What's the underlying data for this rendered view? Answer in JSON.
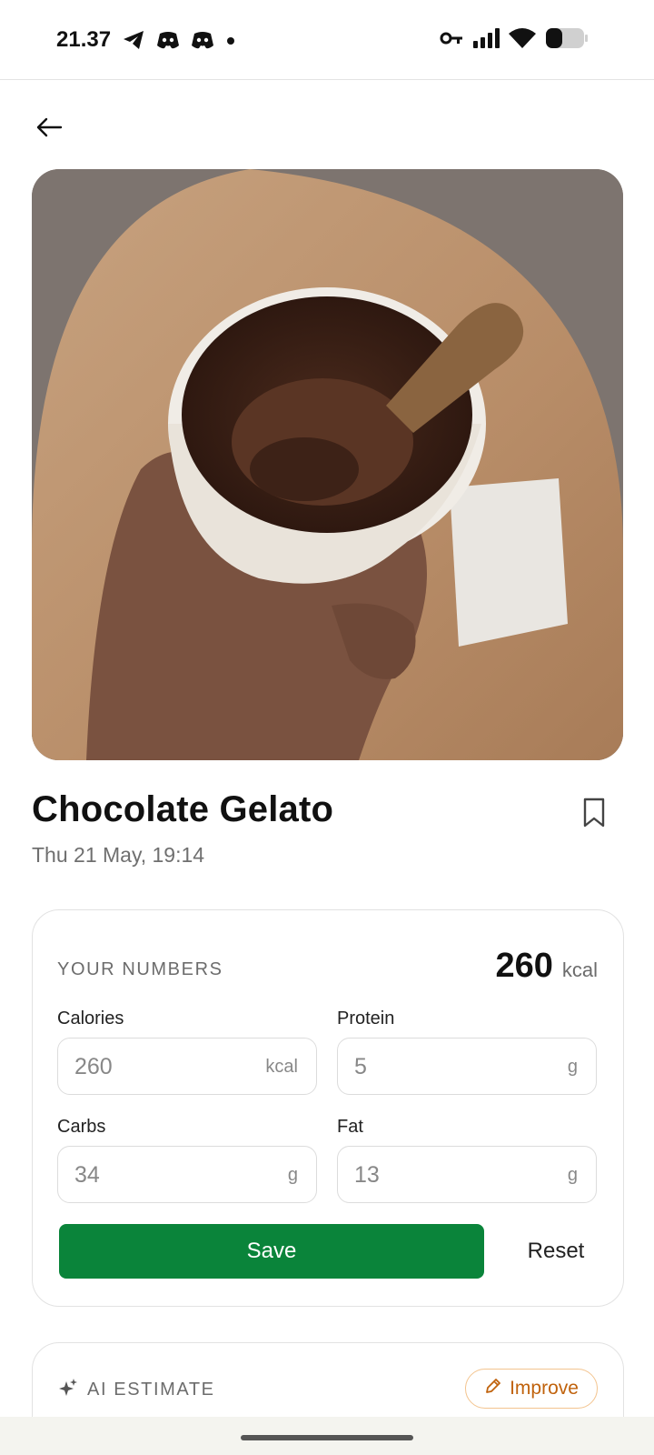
{
  "status_bar": {
    "time": "21.37",
    "left_icons": [
      "telegram-icon",
      "discord-icon",
      "discord-icon",
      "dot-icon"
    ],
    "right_icons": [
      "vpn-key-icon",
      "signal-icon",
      "wifi-icon",
      "battery-icon"
    ],
    "battery_level": 0.4
  },
  "food": {
    "name": "Chocolate Gelato",
    "datetime": "Thu 21 May, 19:14"
  },
  "numbers_card": {
    "label": "YOUR NUMBERS",
    "total_value": "260",
    "total_unit": "kcal",
    "fields": {
      "calories": {
        "label": "Calories",
        "value": "260",
        "unit": "kcal"
      },
      "protein": {
        "label": "Protein",
        "value": "5",
        "unit": "g"
      },
      "carbs": {
        "label": "Carbs",
        "value": "34",
        "unit": "g"
      },
      "fat": {
        "label": "Fat",
        "value": "13",
        "unit": "g"
      }
    },
    "save_label": "Save",
    "reset_label": "Reset"
  },
  "ai_card": {
    "label": "AI ESTIMATE",
    "improve_label": "Improve"
  },
  "colors": {
    "accent_green": "#0a843a",
    "improve_orange": "#c0620c"
  }
}
